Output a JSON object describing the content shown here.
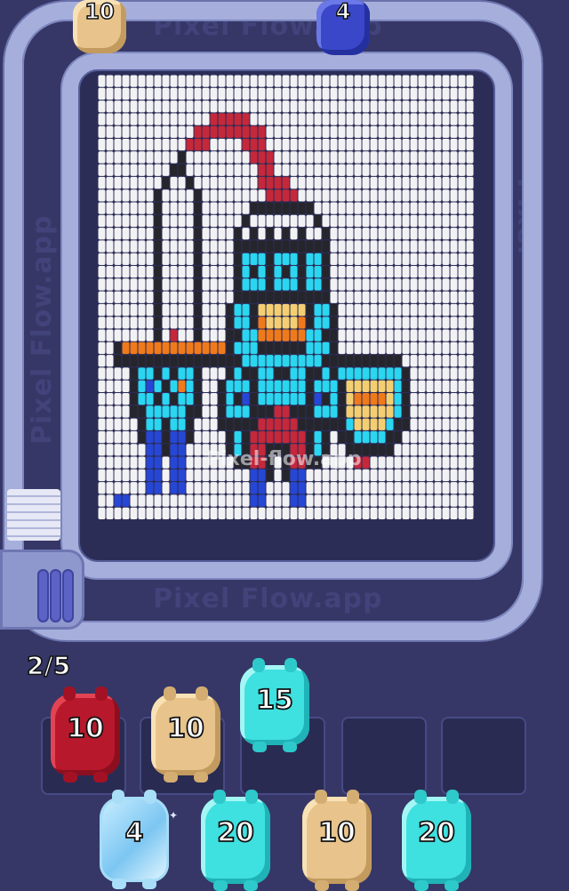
{
  "watermarks": {
    "top": "Pixel Flow.app",
    "bottom": "Pixel Flow.app",
    "side_left": "Pixel Flow.app",
    "side_right": "Pixel Flow.app",
    "center": "Pixel-flow.app"
  },
  "top_shooters": [
    {
      "value": "10",
      "color": "tan"
    },
    {
      "value": "4",
      "color": "blue"
    }
  ],
  "queue_counter": "2/5",
  "slot_shooters": [
    {
      "value": "10",
      "color": "red"
    },
    {
      "value": "10",
      "color": "tan"
    },
    {
      "value": "15",
      "color": "cyan"
    }
  ],
  "bottom_shooters": [
    {
      "value": "4",
      "color": "ice"
    },
    {
      "value": "20",
      "color": "cyan"
    },
    {
      "value": "10",
      "color": "tan"
    },
    {
      "value": "20",
      "color": "cyan"
    }
  ],
  "palette": {
    "W": "#f2f2f4",
    "K": "#25252b",
    "G": "#c9cbd4",
    "C": "#2ad6f0",
    "B": "#2647d6",
    "R": "#c5283a",
    "O": "#f07a1a",
    "Y": "#f4cf72",
    "M": "#8a1a24"
  },
  "pixel_grid": [
    "WWWWWWWWWWWWWWWWWWWWWWWWWWWWWWWWWWWWWWWWWWWWWWW",
    "WWWWWWWWWWWWWWWWWWWWWWWWWWWWWWWWWWWWWWWWWWWWWWW",
    "WWWWWWWWWWWWWWWWWWWWWWWWWWWWWWWWWWWWWWWWWWWWWWW",
    "WWWWWWWWWWWWWWRRRRRWWWWWWWWWWWWWWWWWWWWWWWWWWWW",
    "WWWWWWWWWWWWRRRRRRRRRWWWWWWWWWWWWWWWWWWWWWWWWWW",
    "WWWWWWWWWWWRRRWWWWRRRWWWWWWWWWWWWWWWWWWWWWWWWWW",
    "WWWWWWWWWWKWWWWWWWWRRRWWWWWWWWWWWWWWWWWWWWWWWWW",
    "WWWWWWWWWKKWWWWWWWWWRRWWWWWWWWWWWWWWWWWWWWWWWWW",
    "WWWWWWWWKWWKWWWWWWWWRRRRWWWWWWWWWWWWWWWWWWWWWWW",
    "WWWWWWWKWWWWKWWWWWWWWRRRRWWWWWWWWWWWWWWWWWWWWWW",
    "WWWWWWWKWWWWKWWWWWWKKKKKKKKWWWWWWWWWWWWWWWWWWWW",
    "WWWWWWWKWWWWKWWWWWKWWWWWWWWKWWWWWWWWWWWWWWWWWWW",
    "WWWWWWWKWWWWKWWWWKWKWKWKWKWWKWWWWWWWWWWWWWWWWWW",
    "WWWWWWWKWWWWKWWWWKKKKKKKKKKKKWWWWWWWWWWWWWWWWWW",
    "WWWWWWWKWWWWKWWWWKCCCKCCCKCCKWWWWWWWWWWWWWWWWWW",
    "WWWWWWWKWWWWKWWWWKCKCKCKCKCCKWWWWWWWWWWWWWWWWWW",
    "WWWWWWWKWWWWKWWWWKCCCKCCCKCCKWWWWWWWWWWWWWWWWWW",
    "WWWWWWWKWWWWKWWWWKKKKKKKKKKKKWWWWWWWWWWWWWWWWWW",
    "WWWWWWWKWWWWKWWWKCCKYYYYYYKCCKWWWWWWWWWWWWWWWWW",
    "WWWWWWWKWWWWKWWWKCCKOYYYYOKCCKWWWWWWWWWWWWWWWWW",
    "WWWWWWWKWRWWKWWWKKCCOOOOOOCCKKWWWWWWWWWWWWWWWWW",
    "WWKOOOOOOOOOOOOOKCCCKKKKKKCCCKWWWWWWWWWWWWWWWWW",
    "WWKKKKKKKKKKKKKKKKCCCCCCCCCCKKKKKKKKKKWWWWWWWWW",
    "WWWWKCCKCKCCKWWWKCKKCCKKCCKKCKCCCCCCCCKWWWWWWWW",
    "WWWWKCBCKCOCKWWKCCCKCCCCCCKCCCKYYYYYYCKWWWWWWWW",
    "WWWWKCCKCKCCKWWKCKBKCCCCCCKBKCKYOOOOYCKWWWWWWWW",
    "WWWWKKCCCCCKKWWKCCCKKKRRKKKCCCKYYYYYYCKWWWWWWWW",
    "WWWWWKCCKCCKWWWKKKKKRRRRRKKKKKKCYYYYCKKWWWWWWWW",
    "WWWWWKBBKBBKWWWWKCKRRRRRRRKCKWKKCCCCKKWWWWWWWWW",
    "WWWWWWBBKBBWWWWWKCKRRKKKRRKCKWWKKKKKKWWWWWWWWWW",
    "WWWWWWBBWBBWWWWWWKKRRKWKRRKKWWWWRRWWWWWWWWWWWWW",
    "WWWWWWBBWBBWWWWWWWWBBKWKBBWWWWWWWWWWWWWWWWWWWWW",
    "WWWWWWBBWBBWWWWWWWWBBWWWBBWWWWWWWWWWWWWWWWWWWWW",
    "WWBBWWWWWWWWWWWWWWWBBWWWBBWWWWWWWWWWWWWWWWWWWWW",
    "WWWWWWWWWWWWWWWWWWWWWWWWWWWWWWWWWWWWWWWWWWWWWWW"
  ]
}
